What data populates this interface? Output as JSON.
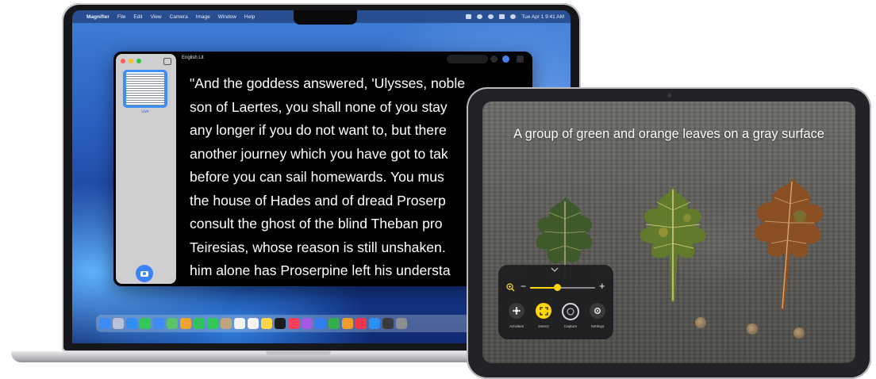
{
  "mac": {
    "menubar": {
      "app_name": "Magnifier",
      "menus": [
        "File",
        "Edit",
        "View",
        "Camera",
        "Image",
        "Window",
        "Help"
      ],
      "clock": "Tue Apr 1  9:41 AM"
    },
    "window": {
      "title": "English Lit",
      "thumbnail_label": "Live",
      "reading_lines": [
        "\"And the goddess answered, 'Ulysses, noble",
        "son of Laertes, you shall none of you stay",
        "any longer if you do not want to, but there",
        "another journey which you have got to tak",
        "before you can sail homewards. You mus",
        "the house of Hades and of dread Proserp",
        "consult the ghost of the blind Theban pro",
        "Teiresias, whose reason is still unshaken.",
        "him alone has Proserpine left his understa"
      ]
    },
    "dock_icons": [
      {
        "name": "finder-icon",
        "color": "#3a8df5"
      },
      {
        "name": "launchpad-icon",
        "color": "#b9c2d6"
      },
      {
        "name": "safari-icon",
        "color": "#2f8ff0"
      },
      {
        "name": "messages-icon",
        "color": "#34c759"
      },
      {
        "name": "mail-icon",
        "color": "#3d8bf7"
      },
      {
        "name": "maps-icon",
        "color": "#5ac36a"
      },
      {
        "name": "photos-icon",
        "color": "#f3a22f"
      },
      {
        "name": "facetime-icon",
        "color": "#30c35a"
      },
      {
        "name": "phone-icon",
        "color": "#34c759"
      },
      {
        "name": "contacts-icon",
        "color": "#bfa57c"
      },
      {
        "name": "calendar-icon",
        "color": "#f4f4f4"
      },
      {
        "name": "reminders-icon",
        "color": "#f4f4f4"
      },
      {
        "name": "notes-icon",
        "color": "#ffd54a"
      },
      {
        "name": "tv-icon",
        "color": "#1c1c1e"
      },
      {
        "name": "music-icon",
        "color": "#fa3f5b"
      },
      {
        "name": "podcasts-icon",
        "color": "#a35ae3"
      },
      {
        "name": "keynote-icon",
        "color": "#2f7ff2"
      },
      {
        "name": "numbers-icon",
        "color": "#34b04a"
      },
      {
        "name": "pages-icon",
        "color": "#f29d2a"
      },
      {
        "name": "news-icon",
        "color": "#f3354a"
      },
      {
        "name": "app-store-icon",
        "color": "#2c8df5"
      },
      {
        "name": "magnifier-icon",
        "color": "#3a3a3c"
      },
      {
        "name": "settings-icon",
        "color": "#8e8e93"
      }
    ]
  },
  "ipad": {
    "caption": "A group of green and orange leaves on a gray surface",
    "panel": {
      "zoom_level": 0.42,
      "buttons": [
        {
          "label": "Activities",
          "name": "activities-button"
        },
        {
          "label": "Detect",
          "name": "detect-button"
        },
        {
          "label": "Capture",
          "name": "capture-button"
        },
        {
          "label": "Settings",
          "name": "settings-button"
        }
      ]
    }
  },
  "colors": {
    "accent_yellow": "#ffd60a",
    "mac_accent_blue": "#3b82f6"
  }
}
